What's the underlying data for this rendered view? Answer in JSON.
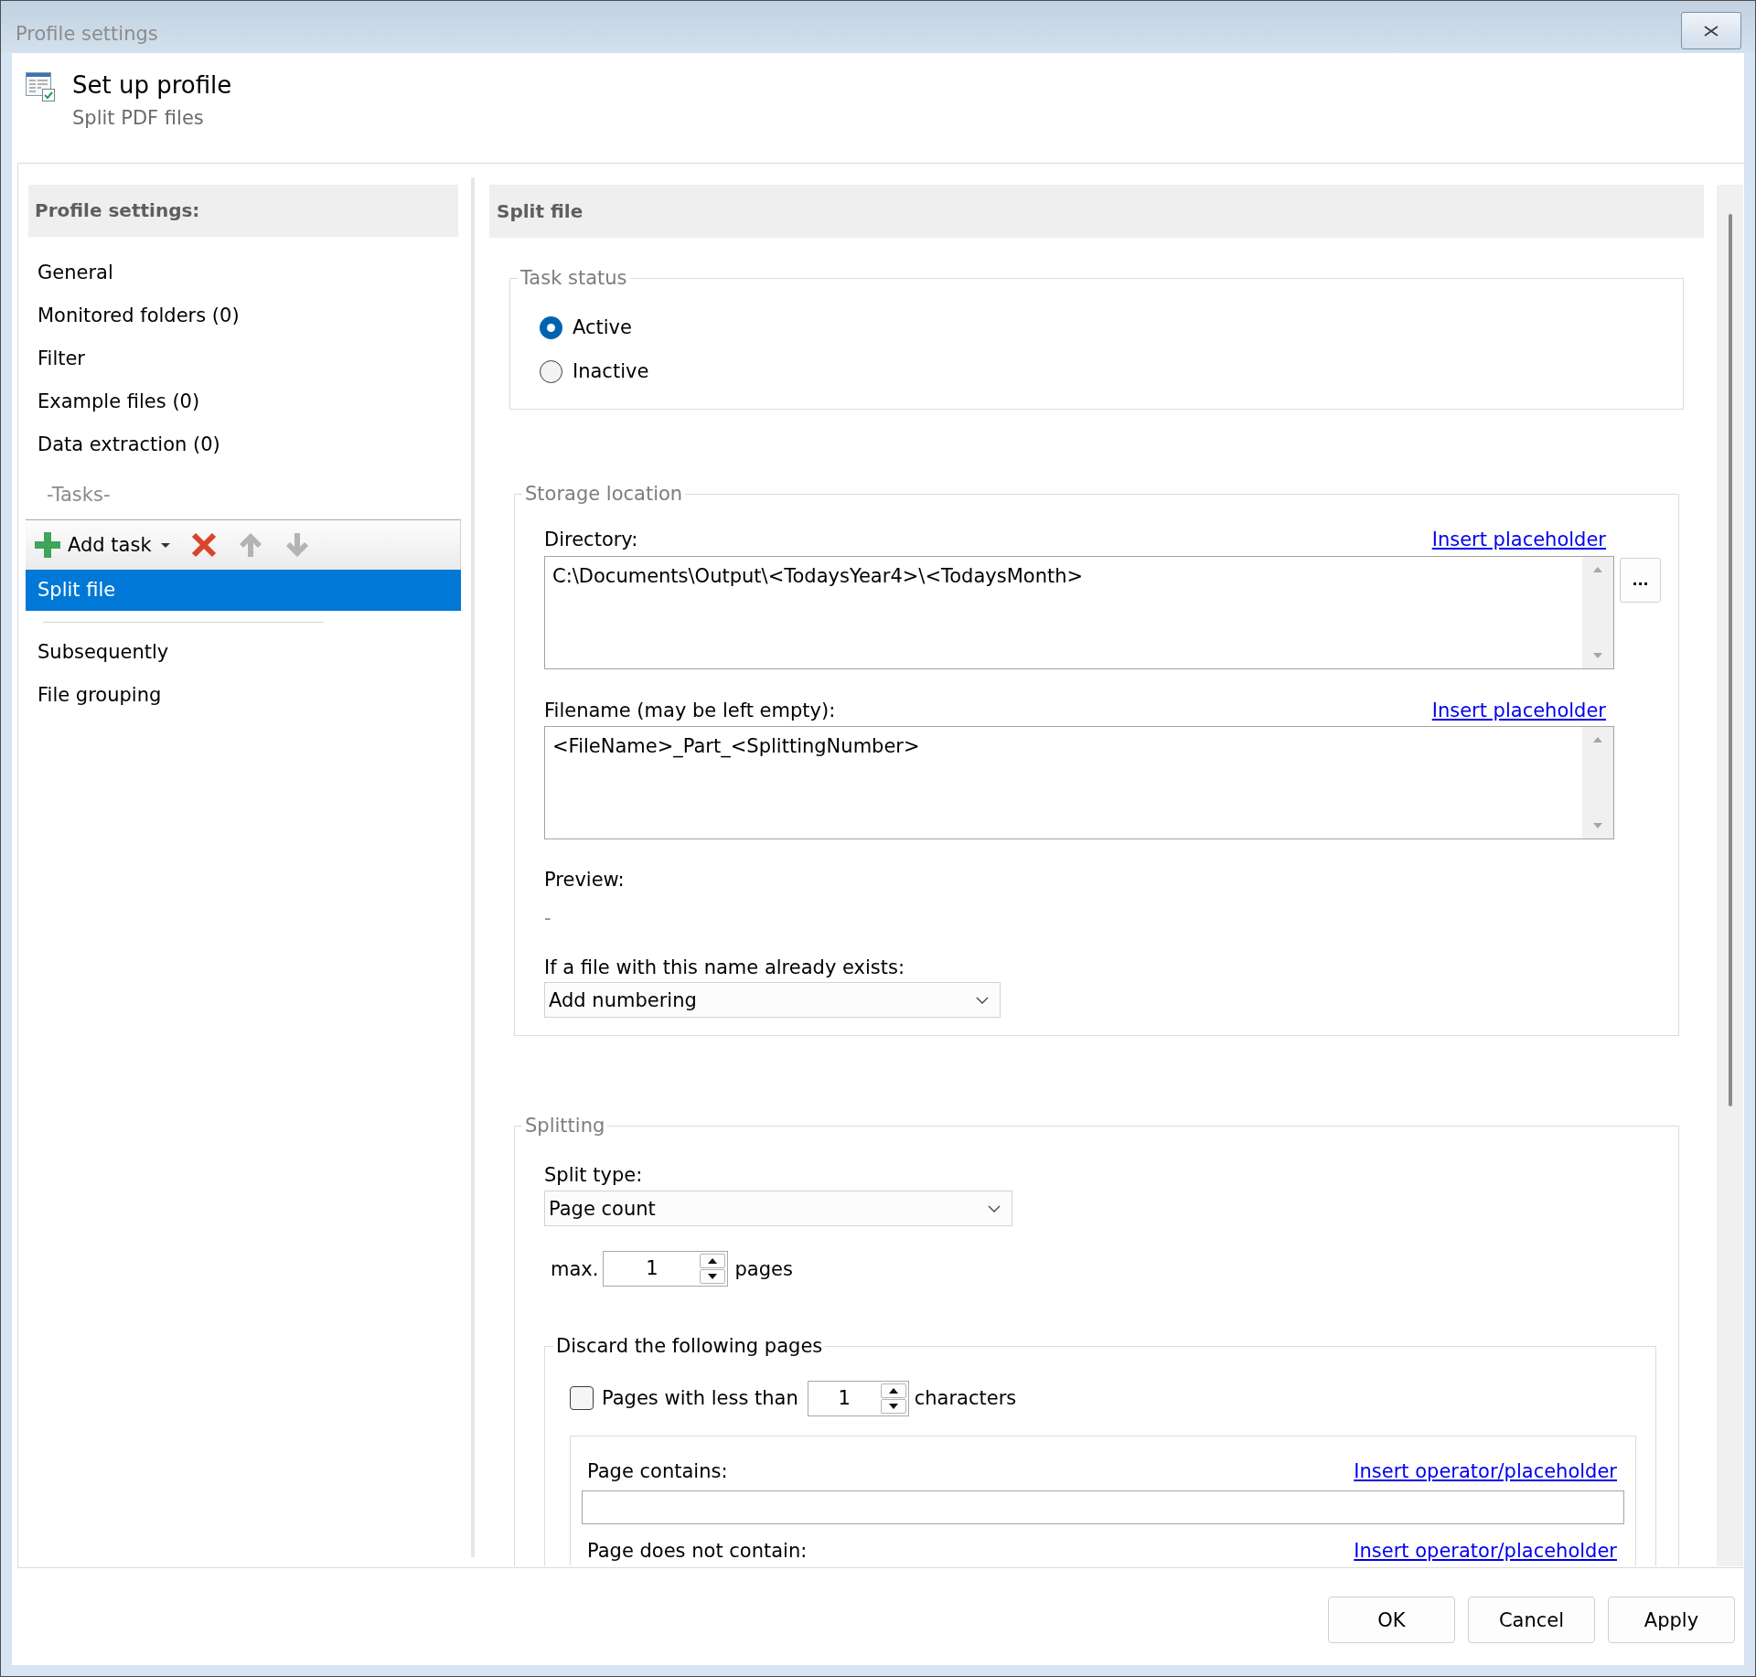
{
  "window": {
    "title": "Profile settings"
  },
  "header": {
    "title": "Set up profile",
    "subtitle": "Split PDF files"
  },
  "sidebar": {
    "title": "Profile settings:",
    "items": [
      {
        "label": "General",
        "selected": false
      },
      {
        "label": "Monitored folders (0)",
        "selected": false
      },
      {
        "label": "Filter",
        "selected": false
      },
      {
        "label": "Example files (0)",
        "selected": false
      },
      {
        "label": "Data extraction (0)",
        "selected": false
      }
    ],
    "tasks_heading": "-Tasks-",
    "toolbar": {
      "add_label": "Add task",
      "tools": [
        {
          "kind": "delete",
          "disabled": false
        },
        {
          "kind": "move_up",
          "disabled": true
        },
        {
          "kind": "move_down",
          "disabled": true
        }
      ]
    },
    "tasks": [
      {
        "label": "Split file",
        "selected": true
      }
    ],
    "more_items": [
      {
        "label": "Subsequently",
        "selected": false
      },
      {
        "label": "File grouping",
        "selected": false
      }
    ]
  },
  "panel": {
    "title": "Split file",
    "task_status": {
      "legend": "Task status",
      "options": [
        {
          "label": "Active",
          "selected": true
        },
        {
          "label": "Inactive",
          "selected": false
        }
      ]
    },
    "storage": {
      "legend": "Storage location",
      "directory": {
        "label": "Directory:",
        "link": "Insert placeholder",
        "value": "C:\\Documents\\Output\\<TodaysYear4>\\<TodaysMonth>",
        "browse": "..."
      },
      "filename": {
        "label": "Filename (may be left empty):",
        "link": "Insert placeholder",
        "value": "<FileName>_Part_<SplittingNumber>"
      },
      "preview": {
        "label": "Preview:",
        "value": "-"
      },
      "if_exists": {
        "label": "If a file with this name already exists:",
        "value": "Add numbering"
      }
    },
    "splitting": {
      "legend": "Splitting",
      "split_type": {
        "label": "Split type:",
        "value": "Page count"
      },
      "max_pages": {
        "prefix": "max.",
        "value": "1",
        "suffix": "pages"
      },
      "discard": {
        "legend": "Discard the following pages",
        "min_characters": {
          "checked": false,
          "prefix": "Pages with less than",
          "value": "1",
          "suffix": "characters"
        },
        "contains": {
          "label": "Page contains:",
          "link": "Insert operator/placeholder"
        },
        "not_contains": {
          "label": "Page does not contain:",
          "link": "Insert operator/placeholder"
        }
      }
    }
  },
  "buttons": [
    {
      "label": "OK"
    },
    {
      "label": "Cancel"
    },
    {
      "label": "Apply"
    }
  ]
}
